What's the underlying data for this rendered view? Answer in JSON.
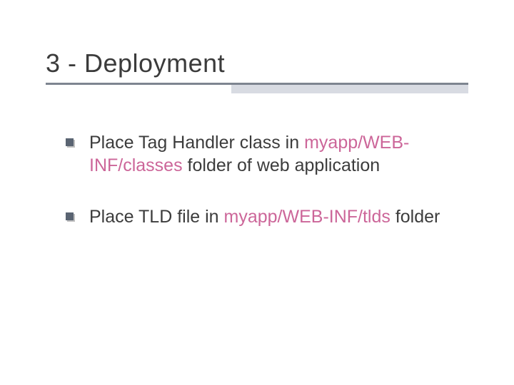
{
  "title": "3 - Deployment",
  "bullets": [
    {
      "pre": "Place Tag Handler class in ",
      "path": "myapp/WEB-INF/classes",
      "post": " folder of web application"
    },
    {
      "pre": "Place TLD file in ",
      "path": "myapp/WEB-INF/tlds",
      "post": " folder"
    }
  ]
}
